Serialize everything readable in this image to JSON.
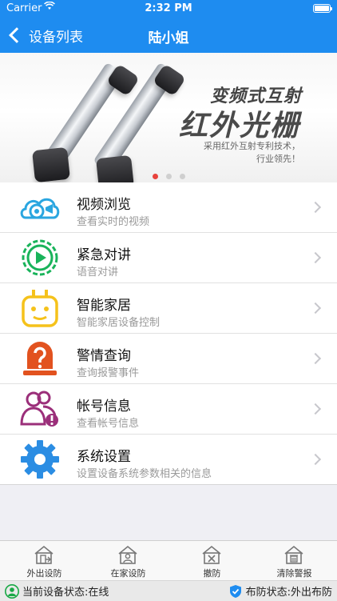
{
  "status_bar": {
    "carrier": "Carrier",
    "time": "2:32 PM"
  },
  "nav": {
    "back_label": "设备列表",
    "title": "陆小姐"
  },
  "banner": {
    "title_line1": "变频式互射",
    "title_line2": "红外光栅",
    "subtitle_line1": "采用红外互射专利技术，",
    "subtitle_line2": "行业领先！",
    "page_count": 3,
    "active_page": 1
  },
  "menu": [
    {
      "title": "视频浏览",
      "subtitle": "查看实时的视频",
      "icon": "video-camera-cloud-icon",
      "color": "#2aa6e0"
    },
    {
      "title": "紧急对讲",
      "subtitle": "语音对讲",
      "icon": "intercom-play-icon",
      "color": "#19b35a"
    },
    {
      "title": "智能家居",
      "subtitle": "智能家居设备控制",
      "icon": "smart-plug-icon",
      "color": "#f5c21b"
    },
    {
      "title": "警情查询",
      "subtitle": "查询报警事件",
      "icon": "alarm-light-icon",
      "color": "#e2521f"
    },
    {
      "title": "帐号信息",
      "subtitle": "查看帐号信息",
      "icon": "account-users-icon",
      "color": "#9b2f7a"
    },
    {
      "title": "系统设置",
      "subtitle": "设置设备系统参数相关的信息",
      "icon": "settings-gear-icon",
      "color": "#2b8de3"
    }
  ],
  "tabbar": [
    {
      "label": "外出设防",
      "icon": "house-exit-icon"
    },
    {
      "label": "在家设防",
      "icon": "house-person-icon"
    },
    {
      "label": "撤防",
      "icon": "house-cancel-icon"
    },
    {
      "label": "清除警报",
      "icon": "house-trash-icon"
    }
  ],
  "footer": {
    "device_status": "当前设备状态:在线",
    "arm_status": "布防状态:外出布防",
    "online_color": "#19a845",
    "shield_color": "#1e8cf0"
  }
}
